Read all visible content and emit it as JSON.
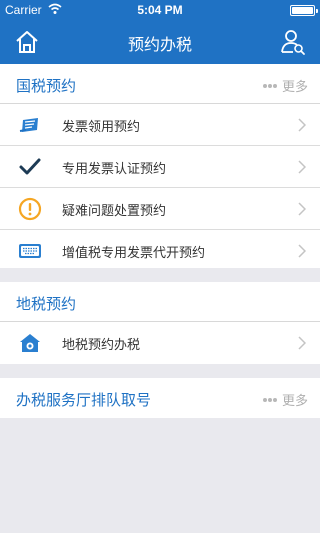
{
  "status_bar": {
    "carrier": "Carrier",
    "time": "5:04 PM"
  },
  "nav": {
    "title": "预约办税",
    "home_icon": "home-icon",
    "user_icon": "user-search-icon"
  },
  "guoshui": {
    "title": "国税预约",
    "more": "更多",
    "items": [
      {
        "label": "发票领用预约",
        "icon": "invoice-icon"
      },
      {
        "label": "专用发票认证预约",
        "icon": "checkmark-icon"
      },
      {
        "label": "疑难问题处置预约",
        "icon": "warning-icon"
      },
      {
        "label": "增值税专用发票代开预约",
        "icon": "keyboard-icon"
      }
    ]
  },
  "dishui": {
    "title": "地税预约",
    "items": [
      {
        "label": "地税预约办税",
        "icon": "tax-office-icon"
      }
    ]
  },
  "queue": {
    "title": "办税服务厅排队取号",
    "more": "更多"
  },
  "colors": {
    "accent": "#1f72c4",
    "background": "#e9e9ee",
    "warning": "#f5a623"
  }
}
